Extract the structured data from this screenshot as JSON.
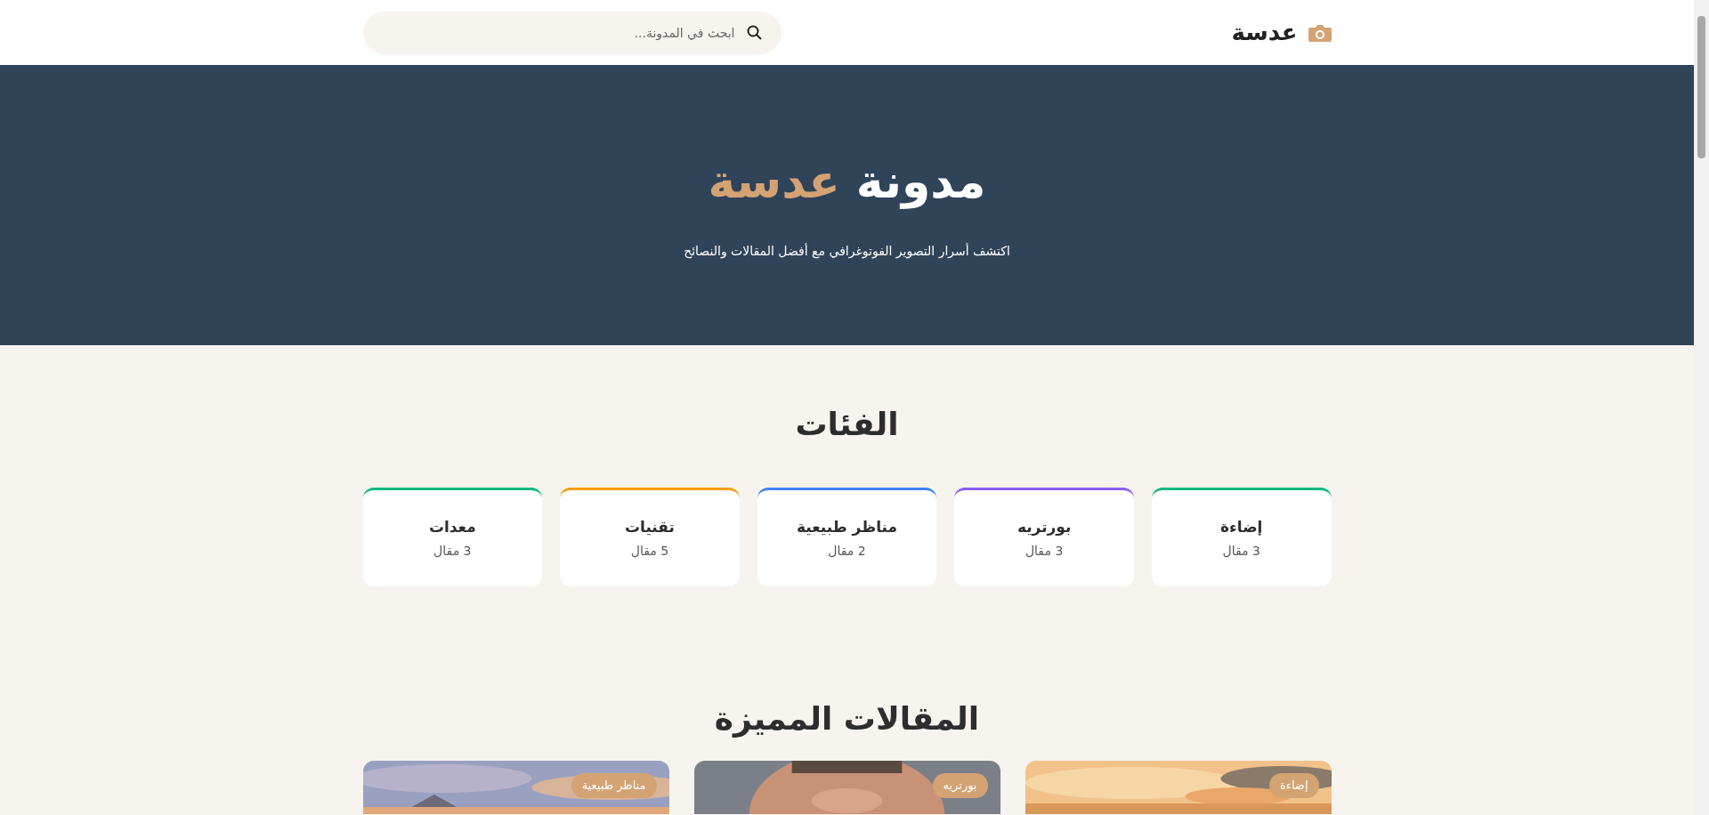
{
  "header": {
    "logo": "عدسة",
    "search": {
      "placeholder": "ابحث في المدونة..."
    }
  },
  "hero": {
    "title_plain": "مدونة",
    "title_accent": "عدسة",
    "subtitle": "اكتشف أسرار التصوير الفوتوغرافي مع أفضل المقالات والنصائح"
  },
  "categories": {
    "title": "الفئات",
    "items": [
      {
        "name": "إضاءة",
        "count": "3 مقال",
        "color": "#10b981"
      },
      {
        "name": "بورتريه",
        "count": "3 مقال",
        "color": "#8b5cf6"
      },
      {
        "name": "مناظر طبيعية",
        "count": "2 مقال",
        "color": "#3b82f6"
      },
      {
        "name": "تقنيات",
        "count": "5 مقال",
        "color": "#f59e0b"
      },
      {
        "name": "معدات",
        "count": "3 مقال",
        "color": "#10b981"
      }
    ]
  },
  "featured": {
    "title": "المقالات المميزة",
    "articles": [
      {
        "category": "إضاءة",
        "kind": "picture"
      },
      {
        "category": "بورتريه",
        "kind": "picture"
      },
      {
        "category": "مناظر طبيعية",
        "kind": "picture"
      }
    ]
  }
}
